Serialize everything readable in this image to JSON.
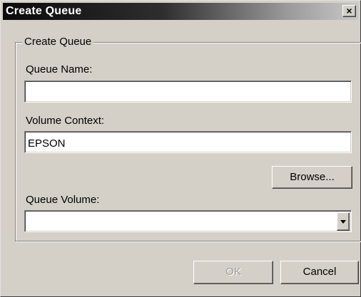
{
  "window": {
    "title": "Create Queue",
    "close_glyph": "×"
  },
  "group": {
    "legend": "Create Queue"
  },
  "fields": {
    "queue_name_label": "Queue Name:",
    "queue_name_value": "",
    "volume_context_label": "Volume Context:",
    "volume_context_value": "EPSON",
    "queue_volume_label": "Queue Volume:",
    "queue_volume_value": ""
  },
  "buttons": {
    "browse": "Browse...",
    "ok": "OK",
    "cancel": "Cancel"
  },
  "state": {
    "ok_enabled": false
  }
}
